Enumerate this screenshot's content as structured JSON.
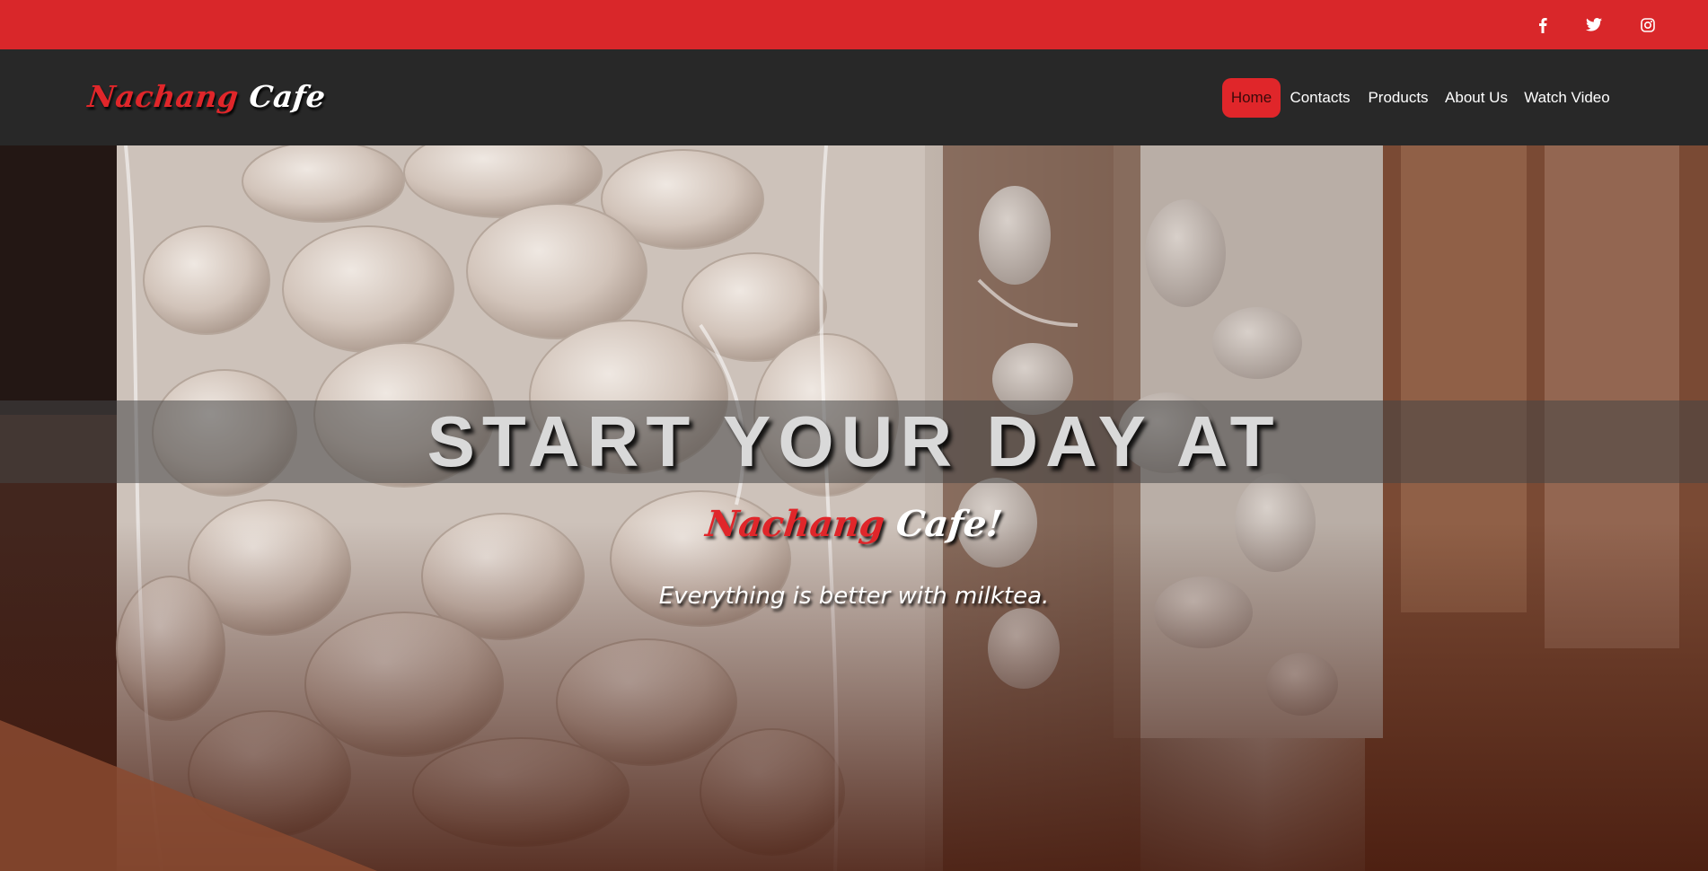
{
  "social": {
    "facebook_icon": "facebook-icon",
    "twitter_icon": "twitter-icon",
    "instagram_icon": "instagram-icon"
  },
  "brand": {
    "name_red": "Nachang",
    "name_white": "Cafe"
  },
  "nav": {
    "items": [
      {
        "label": "Home",
        "active": true
      },
      {
        "label": "Contacts",
        "active": false
      },
      {
        "label": "Products",
        "active": false
      },
      {
        "label": "About Us",
        "active": false
      },
      {
        "label": "Watch Video",
        "active": false
      }
    ]
  },
  "hero": {
    "headline": "START YOUR DAY AT",
    "sub_red": "Nachang",
    "sub_white": "Cafe!",
    "tagline": "Everything is better with milktea."
  },
  "colors": {
    "accent": "#e0262a",
    "topbar": "#d9272a",
    "navbar": "#282828"
  }
}
